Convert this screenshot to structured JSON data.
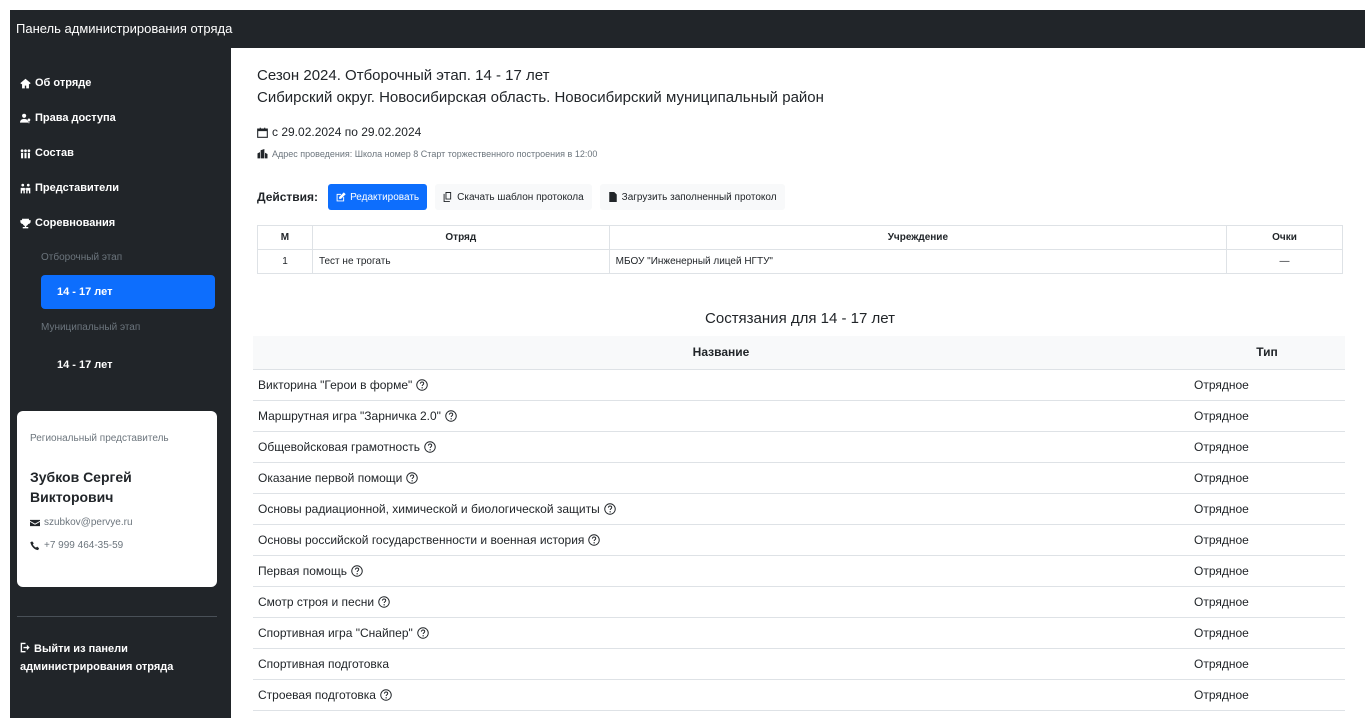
{
  "header": {
    "title": "Панель администрирования отряда"
  },
  "sidebar": {
    "nav": [
      {
        "label": "Об отряде",
        "icon": "home-icon"
      },
      {
        "label": "Права доступа",
        "icon": "users-key-icon"
      },
      {
        "label": "Состав",
        "icon": "people-icon"
      },
      {
        "label": "Представители",
        "icon": "representatives-icon"
      },
      {
        "label": "Соревнования",
        "icon": "trophy-icon"
      }
    ],
    "stage1": {
      "label": "Отборочный этап",
      "age": "14 - 17 лет"
    },
    "stage2": {
      "label": "Муниципальный этап",
      "age": "14 - 17 лет"
    },
    "representative": {
      "role": "Региональный представитель",
      "name": "Зубков Сергей Викторович",
      "email": "szubkov@pervye.ru",
      "phone": "+7 999 464-35-59"
    },
    "logout": "Выйти из панели администрирования отряда"
  },
  "main": {
    "title1": "Сезон 2024. Отборочный этап. 14 - 17 лет",
    "title2": "Сибирский округ. Новосибирская область. Новосибирский муниципальный район",
    "dates": "с 29.02.2024 по 29.02.2024",
    "address": "Адрес проведения: Школа номер 8 Старт торжественного построения в 12:00",
    "actions": {
      "label": "Действия:",
      "edit": "Редактировать",
      "download": "Скачать шаблон протокола",
      "upload": "Загрузить заполненный протокол"
    },
    "results": {
      "headers": [
        "М",
        "Отряд",
        "Учреждение",
        "Очки"
      ],
      "rows": [
        {
          "place": "1",
          "team": "Тест не трогать",
          "org": "МБОУ \"Инженерный лицей НГТУ\"",
          "points": "—"
        }
      ]
    },
    "contests": {
      "title": "Состязания для 14 - 17 лет",
      "headers": [
        "Название",
        "Тип"
      ],
      "rows": [
        {
          "name": "Викторина \"Герои в форме\"",
          "type": "Отрядное",
          "help": true
        },
        {
          "name": "Маршрутная игра \"Зарничка 2.0\"",
          "type": "Отрядное",
          "help": true
        },
        {
          "name": "Общевойсковая грамотность",
          "type": "Отрядное",
          "help": true
        },
        {
          "name": "Оказание первой помощи",
          "type": "Отрядное",
          "help": true
        },
        {
          "name": "Основы радиационной, химической и биологической защиты",
          "type": "Отрядное",
          "help": true
        },
        {
          "name": "Основы российской государственности и военная история",
          "type": "Отрядное",
          "help": true
        },
        {
          "name": "Первая помощь",
          "type": "Отрядное",
          "help": true
        },
        {
          "name": "Смотр строя и песни",
          "type": "Отрядное",
          "help": true
        },
        {
          "name": "Спортивная игра \"Снайпер\"",
          "type": "Отрядное",
          "help": true
        },
        {
          "name": "Спортивная подготовка",
          "type": "Отрядное",
          "help": false
        },
        {
          "name": "Строевая подготовка",
          "type": "Отрядное",
          "help": true
        }
      ]
    }
  },
  "colors": {
    "dark": "#212529",
    "primary": "#0d6efd",
    "muted": "#6c757d",
    "border": "#dee2e6",
    "light": "#f8f9fa"
  }
}
